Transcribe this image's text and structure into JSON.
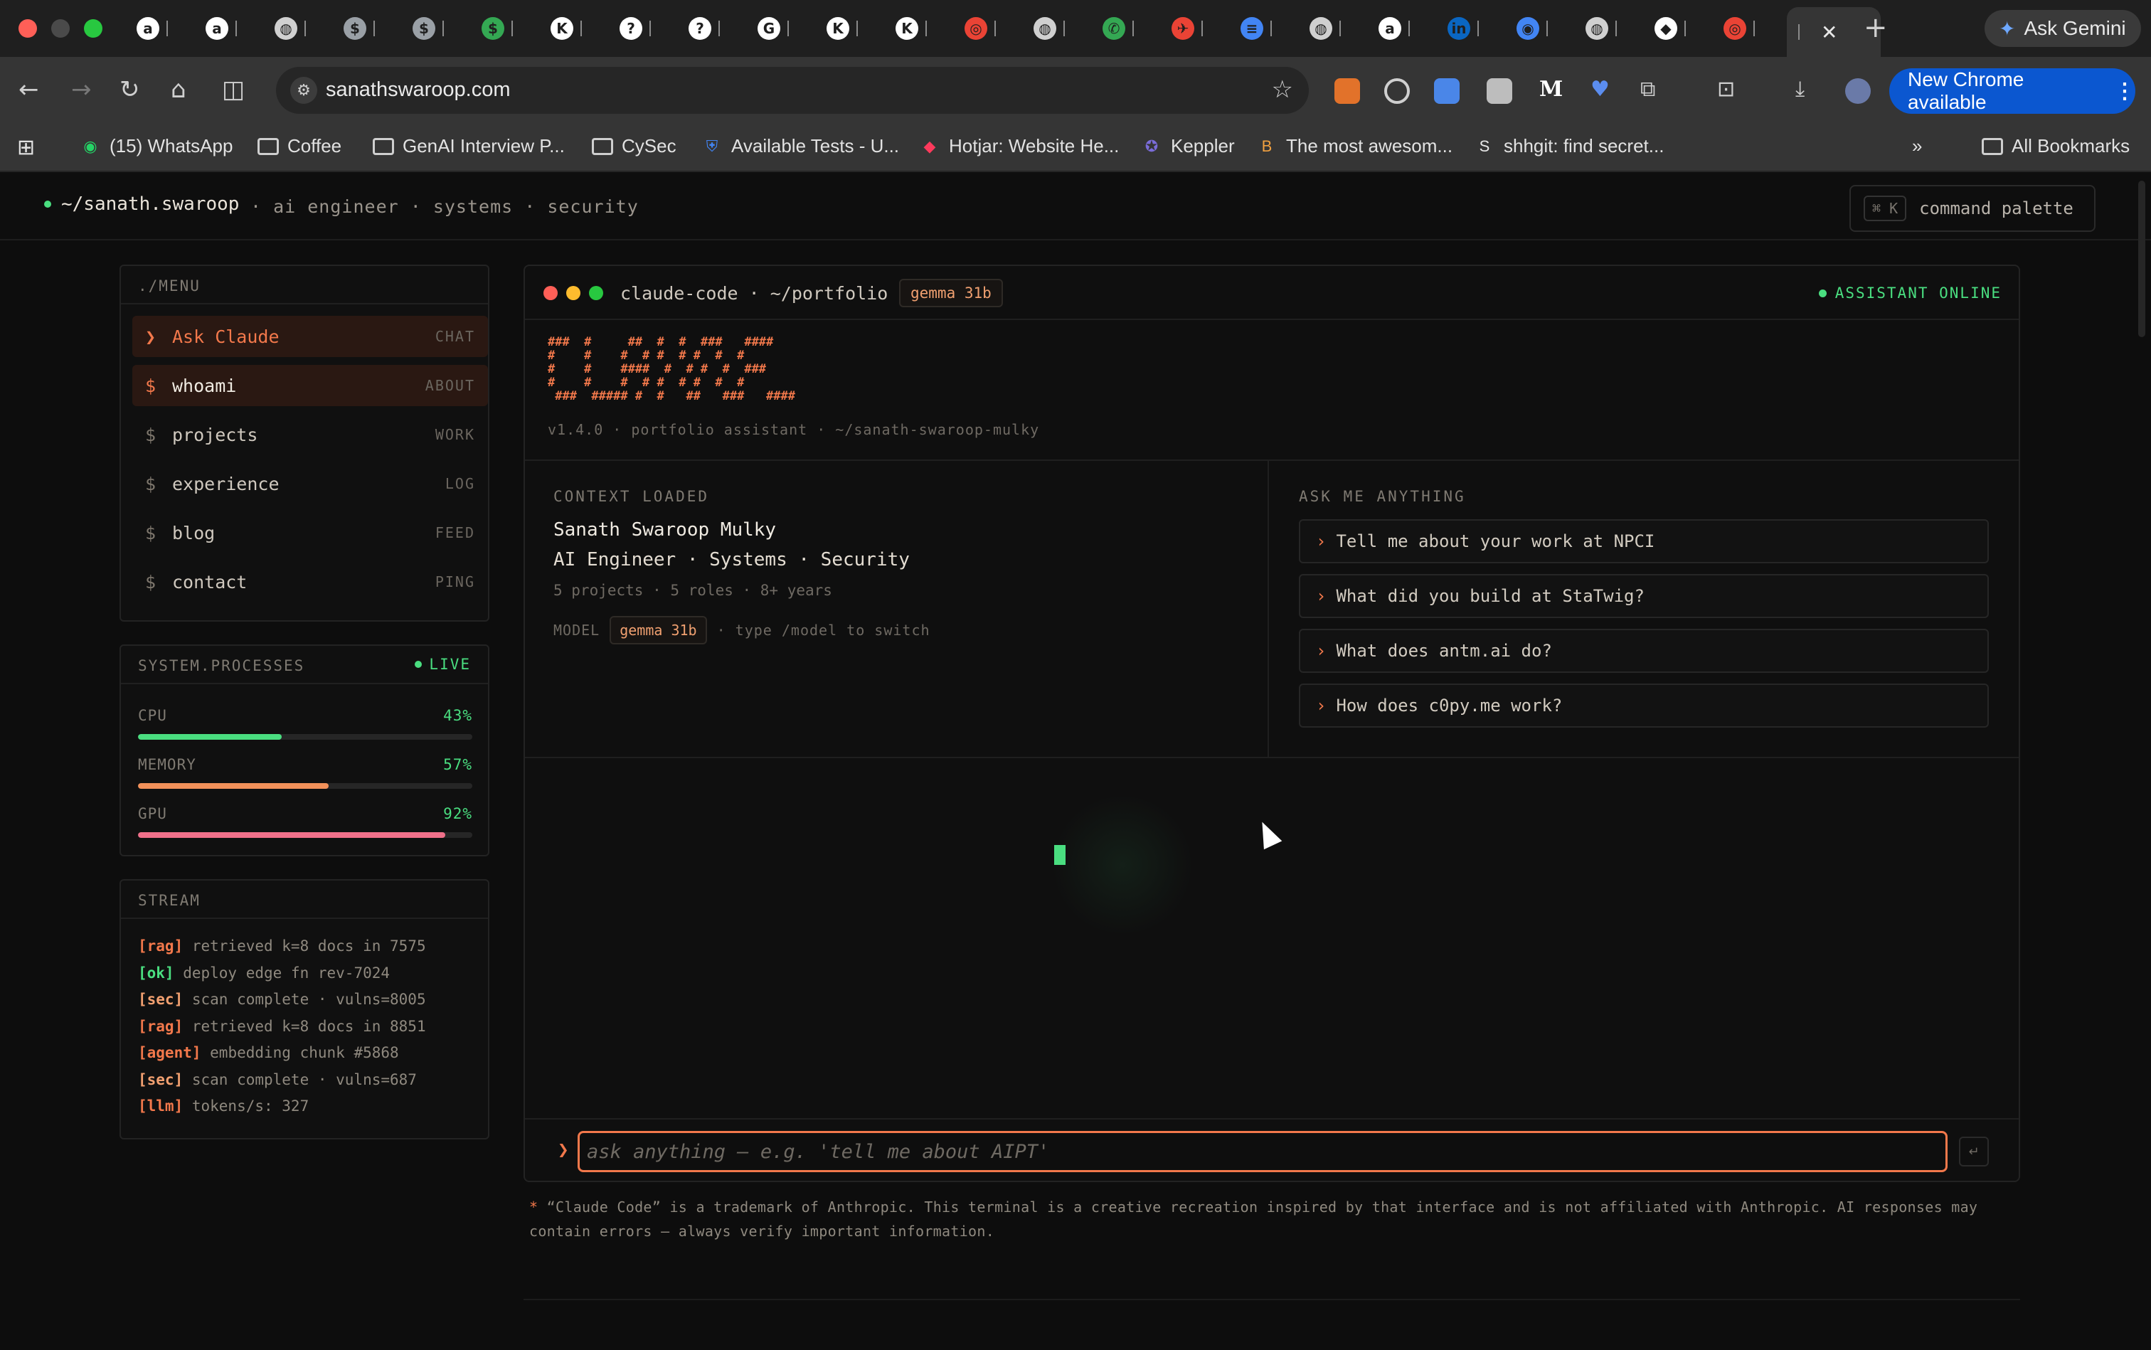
{
  "browser": {
    "url": "sanathswaroop.com",
    "ask_gemini": "Ask Gemini",
    "new_chrome": "New Chrome available",
    "tab_favicons": [
      {
        "glyph": "a",
        "color": "#ffffff"
      },
      {
        "glyph": "a",
        "color": "#ffffff"
      },
      {
        "glyph": "◍",
        "color": "#d0d0d0"
      },
      {
        "glyph": "$",
        "color": "#9aa0a6"
      },
      {
        "glyph": "$",
        "color": "#9aa0a6"
      },
      {
        "glyph": "$",
        "color": "#34a853"
      },
      {
        "glyph": "K",
        "color": "#ffffff"
      },
      {
        "glyph": "?",
        "color": "#ffffff"
      },
      {
        "glyph": "?",
        "color": "#ffffff"
      },
      {
        "glyph": "G",
        "color": "#ffffff"
      },
      {
        "glyph": "K",
        "color": "#ffffff"
      },
      {
        "glyph": "K",
        "color": "#ffffff"
      },
      {
        "glyph": "◎",
        "color": "#ea4335"
      },
      {
        "glyph": "◍",
        "color": "#d0d0d0"
      },
      {
        "glyph": "✆",
        "color": "#34a853"
      },
      {
        "glyph": "✈",
        "color": "#ea4335"
      },
      {
        "glyph": "≡",
        "color": "#4285f4"
      },
      {
        "glyph": "◍",
        "color": "#d0d0d0"
      },
      {
        "glyph": "a",
        "color": "#ffffff"
      },
      {
        "glyph": "in",
        "color": "#0a66c2"
      },
      {
        "glyph": "◉",
        "color": "#4285f4"
      },
      {
        "glyph": "◍",
        "color": "#d0d0d0"
      },
      {
        "glyph": "◆",
        "color": "#ffffff"
      },
      {
        "glyph": "◎",
        "color": "#ea4335"
      }
    ],
    "bookmarks": [
      {
        "label": "(15) WhatsApp",
        "icon": "whatsapp-icon"
      },
      {
        "label": "Coffee",
        "icon": "folder-icon"
      },
      {
        "label": "GenAI Interview P...",
        "icon": "folder-icon"
      },
      {
        "label": "CySec",
        "icon": "folder-icon"
      },
      {
        "label": "Available Tests - U...",
        "icon": "shield-icon"
      },
      {
        "label": "Hotjar: Website He...",
        "icon": "hotjar-icon"
      },
      {
        "label": "Keppler",
        "icon": "keppler-icon"
      },
      {
        "label": "The most awesom...",
        "icon": "bs-icon"
      },
      {
        "label": "shhgit: find secret...",
        "icon": "shhgit-icon"
      }
    ],
    "all_bookmarks": "All Bookmarks"
  },
  "site": {
    "brand": "~/sanath.swaroop",
    "tagline": "· ai engineer · systems · security",
    "command_palette": "command palette",
    "kbd": "⌘ K"
  },
  "menu": {
    "title": "./MENU",
    "items": [
      {
        "prefix": "❯",
        "label": "Ask Claude",
        "tag": "CHAT"
      },
      {
        "prefix": "$",
        "label": "whoami",
        "tag": "ABOUT"
      },
      {
        "prefix": "$",
        "label": "projects",
        "tag": "WORK"
      },
      {
        "prefix": "$",
        "label": "experience",
        "tag": "LOG"
      },
      {
        "prefix": "$",
        "label": "blog",
        "tag": "FEED"
      },
      {
        "prefix": "$",
        "label": "contact",
        "tag": "PING"
      }
    ]
  },
  "processes": {
    "title": "SYSTEM.PROCESSES",
    "live": "LIVE",
    "items": [
      {
        "name": "CPU",
        "value": "43%",
        "fraction": 0.43,
        "color": "#4ade80"
      },
      {
        "name": "MEMORY",
        "value": "57%",
        "fraction": 0.57,
        "color": "#f2915a"
      },
      {
        "name": "GPU",
        "value": "92%",
        "fraction": 0.92,
        "color": "#f0708a"
      }
    ]
  },
  "stream": {
    "title": "STREAM",
    "lines": [
      {
        "key": "[rag]",
        "text": " retrieved k=8 docs in 7575",
        "color": "#f2784b"
      },
      {
        "key": "[ok]",
        "text": " deploy edge fn rev-7024",
        "color": "#4ade80"
      },
      {
        "key": "[sec]",
        "text": " scan complete · vulns=8005",
        "color": "#f2a070"
      },
      {
        "key": "[rag]",
        "text": " retrieved k=8 docs in 8851",
        "color": "#f2784b"
      },
      {
        "key": "[agent]",
        "text": " embedding chunk #5868",
        "color": "#f2784b"
      },
      {
        "key": "[sec]",
        "text": " scan complete · vulns=687",
        "color": "#f2a070"
      },
      {
        "key": "[llm]",
        "text": " tokens/s: 327",
        "color": "#f2784b"
      }
    ]
  },
  "terminal": {
    "title": "claude-code · ~/portfolio",
    "model": "gemma 31b",
    "status": "ASSISTANT ONLINE",
    "ascii": "###  #     ##  #  #  ###   ####\n#    #    #  # #  # #  #  #\n#    #    ####  #  # #  #  ###\n#    #    #  # #  # #  #  #\n ###  ##### #  #   ##   ###   ####",
    "version": "v1.4.0 · portfolio assistant · ~/sanath-swaroop-mulky",
    "context": {
      "label": "CONTEXT LOADED",
      "name": "Sanath Swaroop Mulky",
      "role": "AI Engineer · Systems · Security",
      "stats": "5 projects · 5 roles · 8+ years",
      "model_label": "MODEL",
      "model": "gemma 31b",
      "hint": "· type /model to switch"
    },
    "ask": {
      "label": "ASK ME ANYTHING",
      "suggestions": [
        "Tell me about your work at NPCI",
        "What did you build at StaTwig?",
        "What does antm.ai do?",
        "How does c0py.me work?"
      ]
    },
    "input": {
      "placeholder": "ask anything — e.g. 'tell me about AIPT'",
      "value": "",
      "enter": "↵"
    }
  },
  "disclaimer": {
    "mark": "*",
    "text": " “Claude Code” is a trademark of Anthropic. This terminal is a creative recreation inspired by that interface and is not affiliated with Anthropic. AI responses may contain errors — always verify important information."
  }
}
